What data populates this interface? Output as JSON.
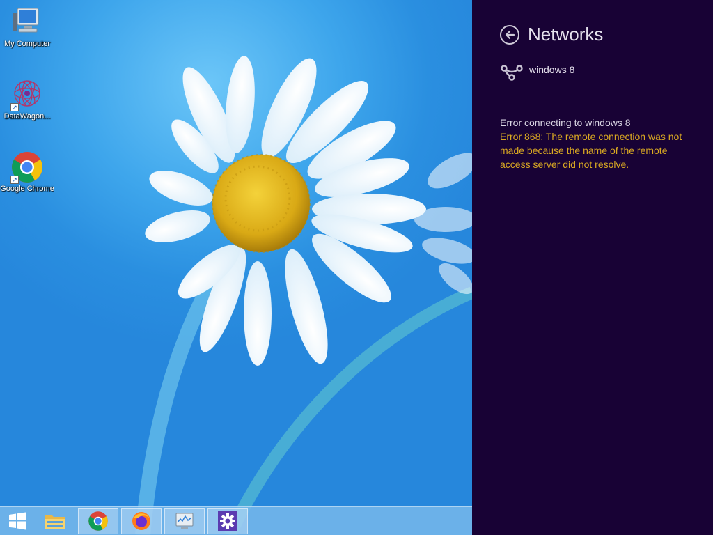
{
  "desktop": {
    "icons": [
      {
        "label": "My Computer",
        "icon": "computer-icon"
      },
      {
        "label": "DataWagon...",
        "icon": "datawagon-icon"
      },
      {
        "label": "Google Chrome",
        "icon": "chrome-icon"
      }
    ]
  },
  "taskbar": {
    "items": [
      {
        "icon": "windows-start-icon"
      },
      {
        "icon": "file-explorer-icon"
      },
      {
        "icon": "chrome-icon"
      },
      {
        "icon": "firefox-icon"
      },
      {
        "icon": "resource-monitor-icon"
      },
      {
        "icon": "settings-gear-icon"
      }
    ]
  },
  "panel": {
    "title": "Networks",
    "network": {
      "name": "windows 8",
      "icon": "dialup-connection-icon"
    },
    "error_title": "Error connecting to windows 8",
    "error_message": "Error 868: The remote connection was not made because the name of the remote access server did not resolve.",
    "colors": {
      "background": "#180235",
      "error": "#d9a822"
    }
  }
}
